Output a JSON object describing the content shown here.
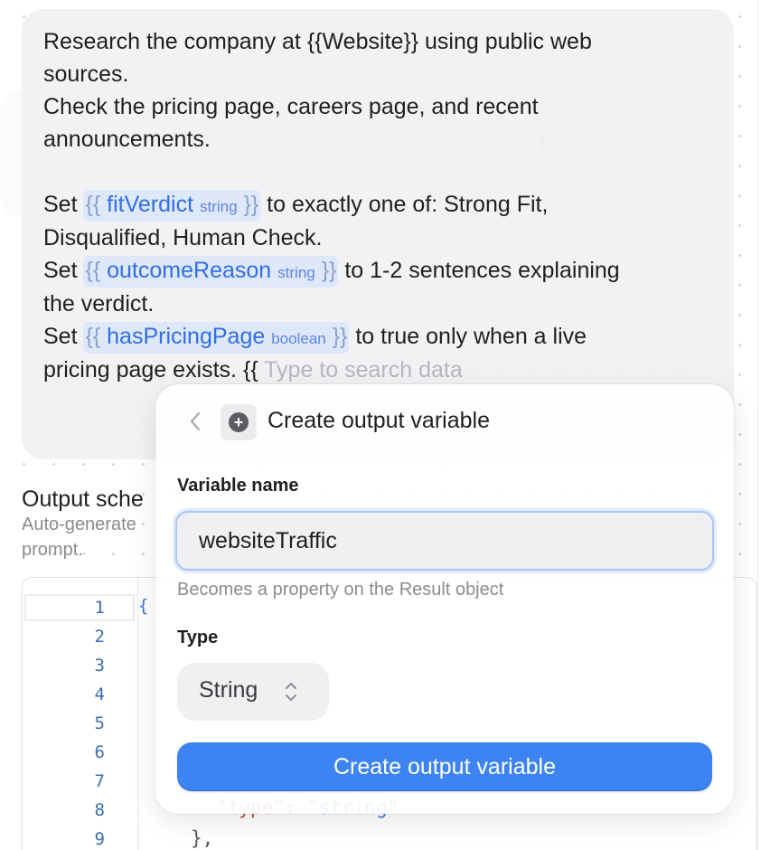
{
  "prompt": {
    "line1": "Research the company at {{Website}} using public web",
    "line2": "sources.",
    "line3": "Check the pricing page, careers page, and recent",
    "line4": "announcements.",
    "set1_prefix": "Set",
    "set1_suffix": " to exactly one of: Strong Fit,",
    "set1_line2": "Disqualified, Human Check.",
    "set2_prefix": "Set",
    "set2_suffix": " to 1-2 sentences explaining",
    "set2_line2": "the verdict.",
    "set3_prefix": "Set",
    "set3_suffix": " to true only when a live",
    "set3_line2_text": "pricing page exists. ",
    "typing_brace": "{{",
    "search_placeholder": "Type to search data",
    "variables": [
      {
        "name": "fitVerdict",
        "type": "string"
      },
      {
        "name": "outcomeReason",
        "type": "string"
      },
      {
        "name": "hasPricingPage",
        "type": "boolean"
      }
    ],
    "brace_open": "{{",
    "brace_close": "}}"
  },
  "schema": {
    "title": "Output sche",
    "subtitle_line1": "Auto-generate",
    "subtitle_line2": "prompt.",
    "line_numbers": [
      "1",
      "2",
      "3",
      "4",
      "5",
      "6",
      "7",
      "8",
      "9"
    ],
    "first_line_brace": "{",
    "type_key": "\"type\"",
    "type_colon": ": ",
    "type_value": "\"string\"",
    "closing": "},"
  },
  "popover": {
    "title": "Create output variable",
    "variable_name_label": "Variable name",
    "variable_name_value": "websiteTraffic",
    "helper_text": "Becomes a property on the Result object",
    "type_label": "Type",
    "type_value": "String",
    "submit_label": "Create output variable"
  },
  "ghost": {
    "braces": "{ }",
    "plus": "+"
  }
}
